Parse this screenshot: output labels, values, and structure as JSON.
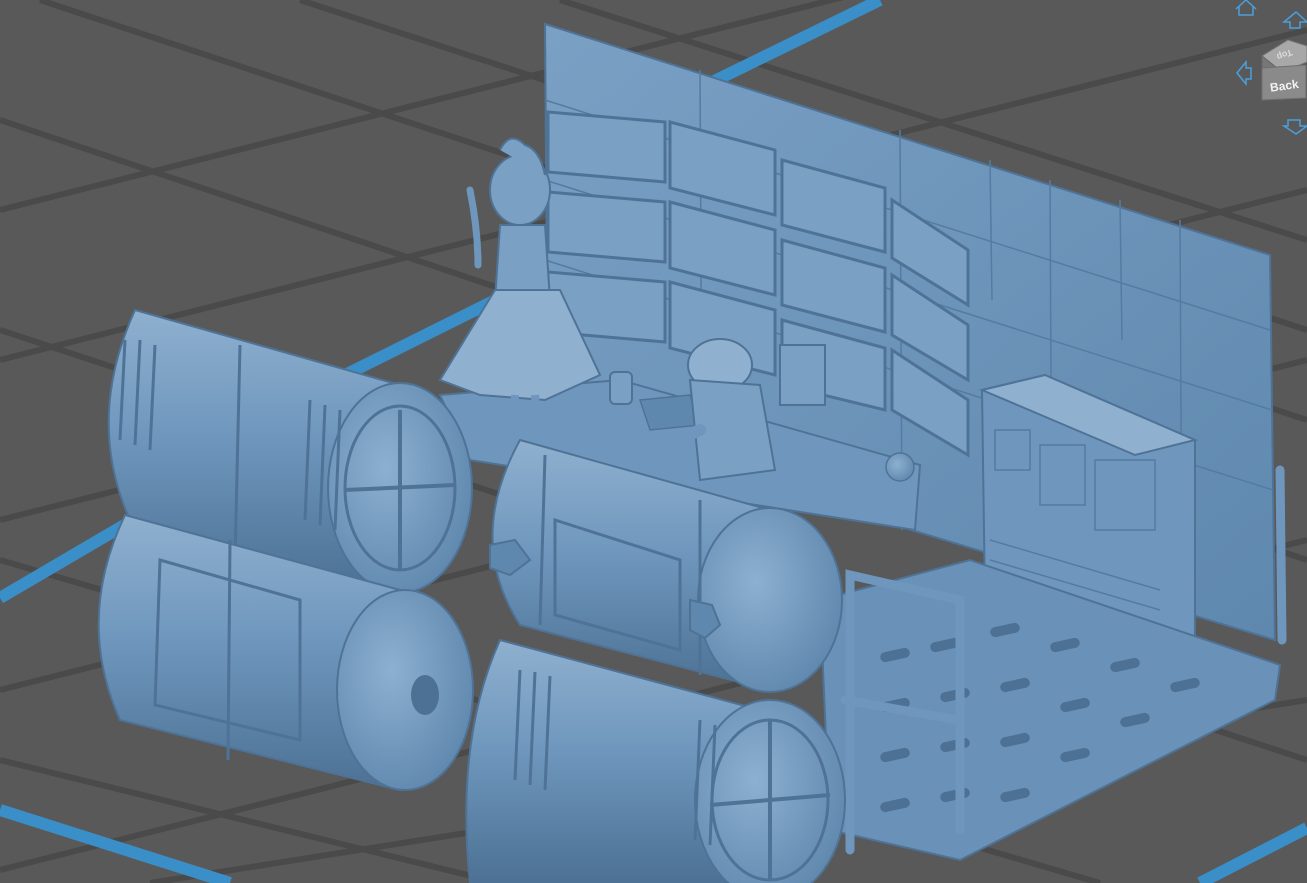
{
  "viewport": {
    "background_color": "#595959",
    "grid_line_color": "#4a4a4a",
    "plate_edge_color": "#3b8fc8",
    "model_color": "#6f97bd",
    "model_shadow_color": "#4f7396",
    "model_highlight_color": "#9dbcd8"
  },
  "view_cube": {
    "front_face_label": "Back",
    "top_face_label": "Top",
    "face_color": "#8a8a8a",
    "top_color": "#a8a8a8",
    "side_color": "#6e6e6e"
  },
  "navigation": {
    "home_icon": "home-icon",
    "up_icon": "arrow-up-icon",
    "left_icon": "arrow-left-icon",
    "down_icon": "arrow-down-icon",
    "icon_color": "#4aa0dc"
  }
}
